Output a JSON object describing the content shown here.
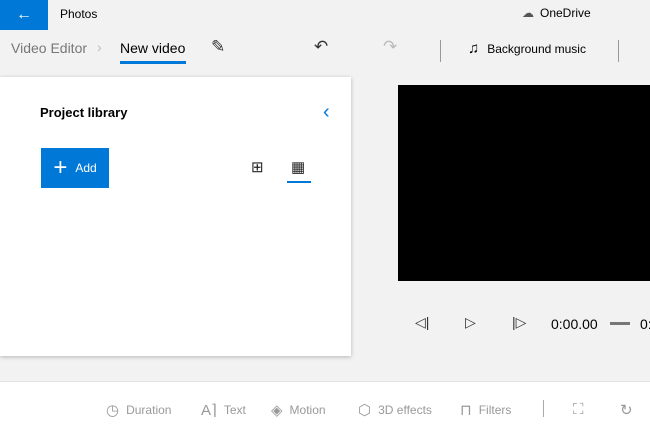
{
  "titlebar": {
    "title": "Photos",
    "account": "OneDrive"
  },
  "breadcrumb": {
    "parent": "Video Editor",
    "current": "New video"
  },
  "toolbar": {
    "background_music": "Background music"
  },
  "library": {
    "title": "Project library",
    "add_label": "Add"
  },
  "player": {
    "time": "0:00.00",
    "end_time_partial": "0:"
  },
  "bottom": {
    "duration": "Duration",
    "text": "Text",
    "motion": "Motion",
    "effects3d": "3D effects",
    "filters": "Filters"
  },
  "colors": {
    "accent": "#0078d7"
  }
}
